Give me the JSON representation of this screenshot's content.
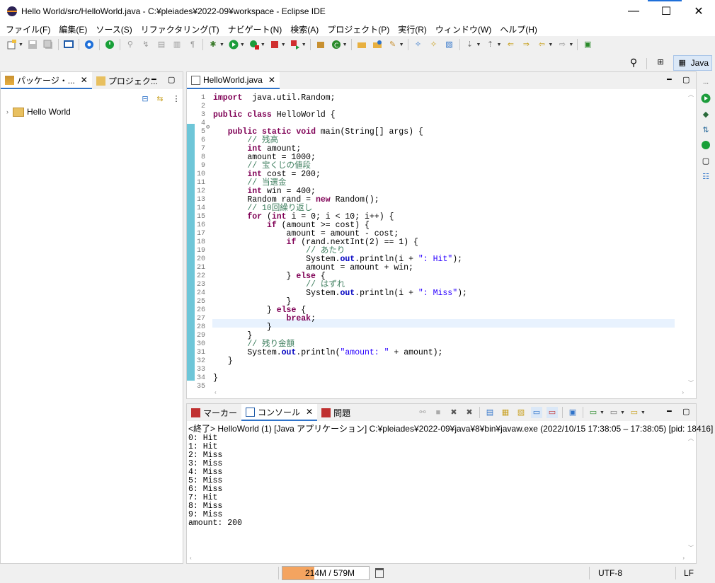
{
  "window": {
    "title": "Hello World/src/HelloWorld.java - C:¥pleiades¥2022-09¥workspace - Eclipse IDE",
    "minimize": "—",
    "maximize": "☐",
    "close": "✕"
  },
  "menu": [
    "ファイル(F)",
    "編集(E)",
    "ソース(S)",
    "リファクタリング(T)",
    "ナビゲート(N)",
    "検索(A)",
    "プロジェクト(P)",
    "実行(R)",
    "ウィンドウ(W)",
    "ヘルプ(H)"
  ],
  "perspective": {
    "label": "Java"
  },
  "left_panel": {
    "tab1": "パッケージ・...",
    "tab2": "プロジェク...",
    "project": "Hello World"
  },
  "editor": {
    "tab": "HelloWorld.java",
    "lines": [
      "1",
      "2",
      "3",
      "4",
      "5",
      "6",
      "7",
      "8",
      "9",
      "10",
      "11",
      "12",
      "13",
      "14",
      "15",
      "16",
      "17",
      "18",
      "19",
      "20",
      "21",
      "22",
      "23",
      "24",
      "25",
      "26",
      "27",
      "28",
      "29",
      "30",
      "31",
      "32",
      "33",
      "34",
      "35"
    ]
  },
  "bottom_panel": {
    "tab_markers": "マーカー",
    "tab_console": "コンソール",
    "tab_problems": "問題",
    "console_header": "<終了> HelloWorld (1) [Java アプリケーション] C:¥pleiades¥2022-09¥java¥8¥bin¥javaw.exe  (2022/10/15 17:38:05 – 17:38:05) [pid: 18416]",
    "output": [
      "0: Hit",
      "1: Hit",
      "2: Miss",
      "3: Miss",
      "4: Miss",
      "5: Miss",
      "6: Miss",
      "7: Hit",
      "8: Miss",
      "9: Miss",
      "amount: 200"
    ]
  },
  "status": {
    "heap": "214M / 579M",
    "heap_used_fraction": 0.37,
    "encoding": "UTF-8",
    "line_ending": "LF"
  },
  "colors": {
    "keyword": "#7f0055",
    "comment": "#3f7f5f",
    "string": "#2a00ff",
    "field": "#0000c0",
    "accent": "#2f73c9"
  }
}
